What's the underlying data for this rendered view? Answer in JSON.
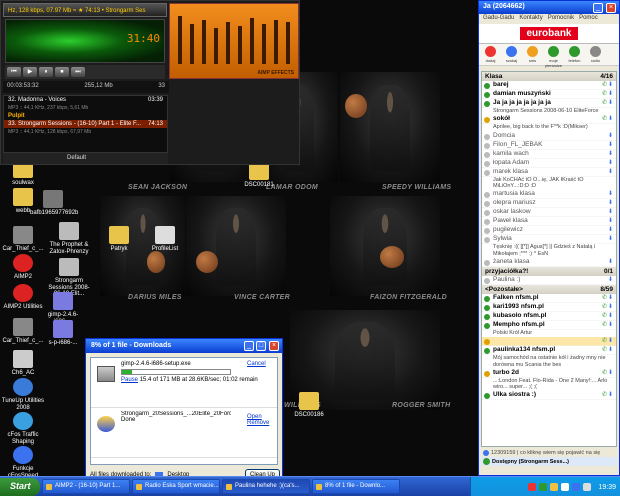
{
  "wallpaper": {
    "players": [
      "SEAN JACKSON",
      "LAMAR ODOM",
      "SPEEDY WILLIAMS",
      "DARIUS MILES",
      "VINCE CARTER",
      "FAIZON FITZGERALD",
      "WILLIAMS",
      "ROGGER SMITH"
    ]
  },
  "desktop_icons": [
    {
      "label": "soulwax"
    },
    {
      "label": "webb"
    },
    {
      "label": "Car_Thief_c_..."
    },
    {
      "label": "AIMP2"
    },
    {
      "label": "AIMP2 Utilities"
    },
    {
      "label": "Car_Thief_c_..."
    },
    {
      "label": "Ch6_AC"
    },
    {
      "label": "TuneUp Utilities 2008"
    },
    {
      "label": "cFos Traffic Shaping"
    },
    {
      "label": "Funkcje cFosSpeed"
    },
    {
      "label": "bafb1965977692b"
    },
    {
      "label": "The Prophet & Zatox-Phrenzy"
    },
    {
      "label": "Strongarm Sessions 2008-06-10 Elit..."
    },
    {
      "label": "Patryk"
    },
    {
      "label": "ProfileList"
    },
    {
      "label": "DSC00181"
    },
    {
      "label": "DSC00186"
    },
    {
      "label": "gimp-2.4.6-i686-..."
    },
    {
      "label": "s-p-i686-..."
    }
  ],
  "aimp": {
    "top_text": "Hz, 128 kbps, 07.97 Mb ≈  ★ 74:13 • Strongarm Ses",
    "time": "31:40",
    "info_left": "00:03:53:32",
    "info_mid": "255,12 Mb",
    "info_right": "33",
    "eq_label": "AIMP EFFECTS",
    "playlist": [
      {
        "text": "32. Madonna - Voices",
        "time": "03:39",
        "kind": "normal"
      },
      {
        "text": "MP3 :: 44,1 KHz, 237 kbps, 5,61 Mb",
        "time": "",
        "kind": "sub"
      },
      {
        "text": "Pulpit",
        "time": "",
        "kind": "hdr"
      },
      {
        "text": "33. Strongarm Sessions - (16-10) Part 1 - Elite F...",
        "time": "74:13",
        "kind": "sel"
      },
      {
        "text": "MP3 :: 44,1 KHz, 128 kbps, 67,97 Mb",
        "time": "",
        "kind": "sub"
      }
    ],
    "preset": "Default",
    "buttons": [
      "⏮",
      "▶",
      "⏸",
      "⏹",
      "⏭"
    ]
  },
  "download": {
    "title": "8% of 1 file - Downloads",
    "items": [
      {
        "file": "gimp-2.4.6-i686-setup.exe",
        "status": "Pause",
        "detail": "15.4 of 171 MB at 28.6KB/sec; 01:02 remain",
        "progress": 0.09,
        "actions": [
          "Cancel"
        ]
      },
      {
        "file": "Strongarm_20Sessions_...20Elite_20Force.mp3",
        "status": "Done",
        "detail": "",
        "progress": null,
        "actions": [
          "Open",
          "Remove"
        ]
      }
    ],
    "footer_label": "All files downloaded to:",
    "footer_folder": "Desktop",
    "clean_up": "Clean Up"
  },
  "gg": {
    "title": "Ja (2064662)",
    "menu": [
      "Gadu-Gadu",
      "Kontakty",
      "Pomocnik",
      "Pomoc"
    ],
    "banner": "eurobank",
    "tools": [
      "dodaj",
      "szukaj",
      "sms",
      "moje pieniadze",
      "telefon",
      "radio"
    ],
    "groups": [
      {
        "name": "Klasa",
        "count": "4/16",
        "contacts": [
          {
            "name": "barej",
            "desc": "",
            "online": true,
            "color": "#2e9a2e"
          },
          {
            "name": "damian muszyński",
            "desc": "",
            "online": true,
            "color": "#2e9a2e"
          },
          {
            "name": "Ja ja ja ja ja ja ja ja",
            "desc": "Strongarm Sessions 2008-06-10 EliteForce",
            "online": true,
            "color": "#2e9a2e"
          },
          {
            "name": "sokół",
            "desc": "Aprilee, big back to the F**k :D(Mikser)",
            "online": true,
            "color": "#e0a000"
          },
          {
            "name": "Domcia",
            "desc": "",
            "online": false,
            "color": "#bbb"
          },
          {
            "name": "Filon_FL_JEBAK",
            "desc": "",
            "online": false,
            "color": "#bbb"
          },
          {
            "name": "kamila wach",
            "desc": "",
            "online": false,
            "color": "#bbb"
          },
          {
            "name": "łopata Adam",
            "desc": "",
            "online": false,
            "color": "#bbb"
          },
          {
            "name": "marek klasa",
            "desc": "Jak KoCHAć tO Ó...ię, JAK łKraść tO MiLiOnY...:D:D :D",
            "online": false,
            "color": "#bbb"
          },
          {
            "name": "martusia klasa",
            "desc": "",
            "online": false,
            "color": "#bbb"
          },
          {
            "name": "olepra mariusz",
            "desc": "",
            "online": false,
            "color": "#bbb"
          },
          {
            "name": "oskar laskow",
            "desc": "",
            "online": false,
            "color": "#bbb"
          },
          {
            "name": "Paweł klasa",
            "desc": "",
            "online": false,
            "color": "#bbb"
          },
          {
            "name": "pugilewicz",
            "desc": "",
            "online": false,
            "color": "#bbb"
          },
          {
            "name": "Sylwia",
            "desc": "Tęsknię :(( [[*]] Agus[*] || Gdzieś z Natalą i Mikołajem ;*** :) ^ EsN",
            "online": false,
            "color": "#bbb"
          },
          {
            "name": "żaneta klasa",
            "desc": "",
            "online": false,
            "color": "#bbb"
          }
        ]
      },
      {
        "name": "przyjaciółka?!",
        "count": "0/1",
        "contacts": [
          {
            "name": "Paulina :)",
            "desc": "",
            "online": false,
            "color": "#bbb"
          }
        ]
      },
      {
        "name": "<Pozostałe>",
        "count": "8/59",
        "contacts": [
          {
            "name": "Falken nfsm.pl",
            "desc": "",
            "online": true,
            "color": "#2e9a2e"
          },
          {
            "name": "kari1993 nfsm.pl",
            "desc": "",
            "online": true,
            "color": "#2e9a2e"
          },
          {
            "name": "kubasolo nfsm.pl",
            "desc": "",
            "online": true,
            "color": "#2e9a2e"
          },
          {
            "name": "Mempho nfsm.pl",
            "desc": "Polski Król Artur",
            "online": true,
            "color": "#2e9a2e"
          },
          {
            "name": "",
            "desc": "",
            "online": true,
            "color": "#e0a000"
          },
          {
            "name": "paulinka134 nfsm.pl",
            "desc": "Mój samochód na ostatnie kół i żadny mny nie dorówna mu Scania the bes",
            "online": true,
            "color": "#2e9a2e"
          },
          {
            "name": "turbo 2d",
            "desc": "...:London Feat. Flo-Rida - One 2 Many!:... Arlo wiro... super... ;( ;(",
            "online": true,
            "color": "#e0a000"
          },
          {
            "name": "Ulka siostra :)",
            "desc": "",
            "online": true,
            "color": "#2e9a2e"
          }
        ]
      }
    ],
    "status_line": "12309159 | co kliknę wiem się pojawić na się",
    "status_available": "Dostępny (Strongarm Sess...)"
  },
  "taskbar": {
    "start": "Start",
    "items": [
      "AIMP2 - (16-10) Part 1...",
      "Radio Eska Sport wmacie...",
      "Paulina hehehe :)(ca's...",
      "8% of 1 file - Downlo..."
    ],
    "clock": "19:39"
  }
}
